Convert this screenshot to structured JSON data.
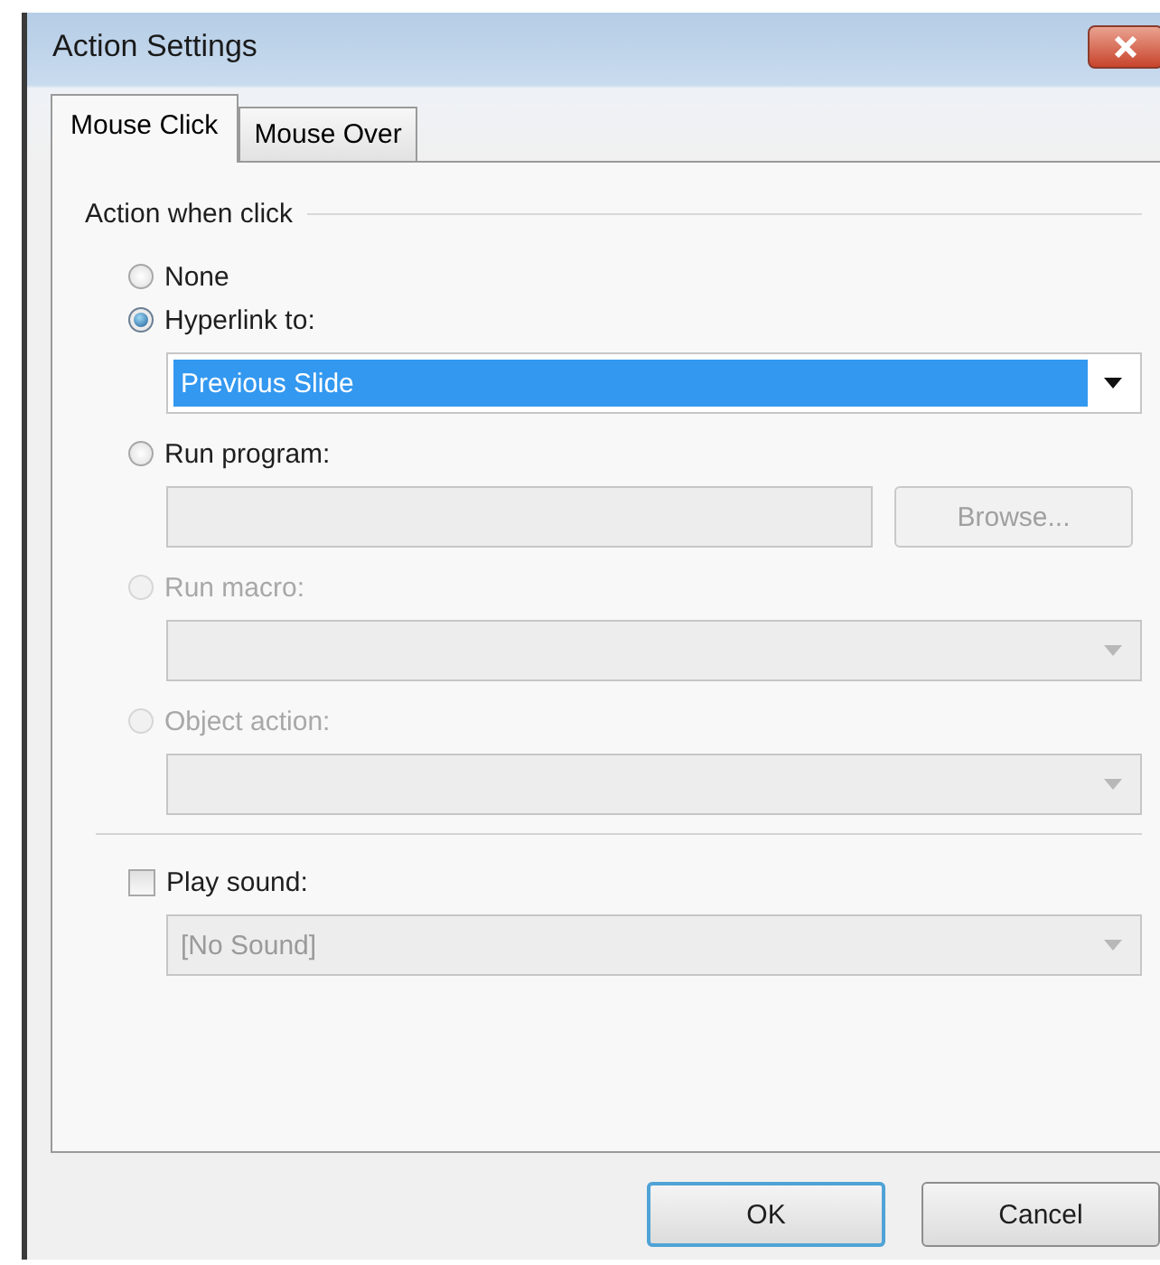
{
  "window": {
    "title": "Action Settings"
  },
  "tabs": [
    {
      "label": "Mouse Click",
      "selected": true
    },
    {
      "label": "Mouse Over",
      "selected": false
    }
  ],
  "group": {
    "title": "Action when click"
  },
  "actions": [
    {
      "label": "None",
      "selected": false,
      "disabled": false
    },
    {
      "label": "Hyperlink to:",
      "selected": true,
      "disabled": false,
      "field": {
        "kind": "dropdown",
        "value": "Previous Slide",
        "highlighted": true,
        "disabled": false
      }
    },
    {
      "label": "Run program:",
      "selected": false,
      "disabled": false,
      "field": {
        "kind": "text_browse",
        "button": "Browse...",
        "disabled": true
      }
    },
    {
      "label": "Run macro:",
      "selected": false,
      "disabled": true,
      "field": {
        "kind": "dropdown",
        "disabled": true
      }
    },
    {
      "label": "Object action:",
      "selected": false,
      "disabled": true,
      "field": {
        "kind": "dropdown",
        "disabled": true
      }
    }
  ],
  "play_sound": {
    "label": "Play sound:",
    "checked": false,
    "field": {
      "kind": "dropdown",
      "value": "[No Sound]",
      "disabled": true
    }
  },
  "buttons": [
    {
      "label": "OK",
      "default": true
    },
    {
      "label": "Cancel",
      "default": false
    }
  ]
}
